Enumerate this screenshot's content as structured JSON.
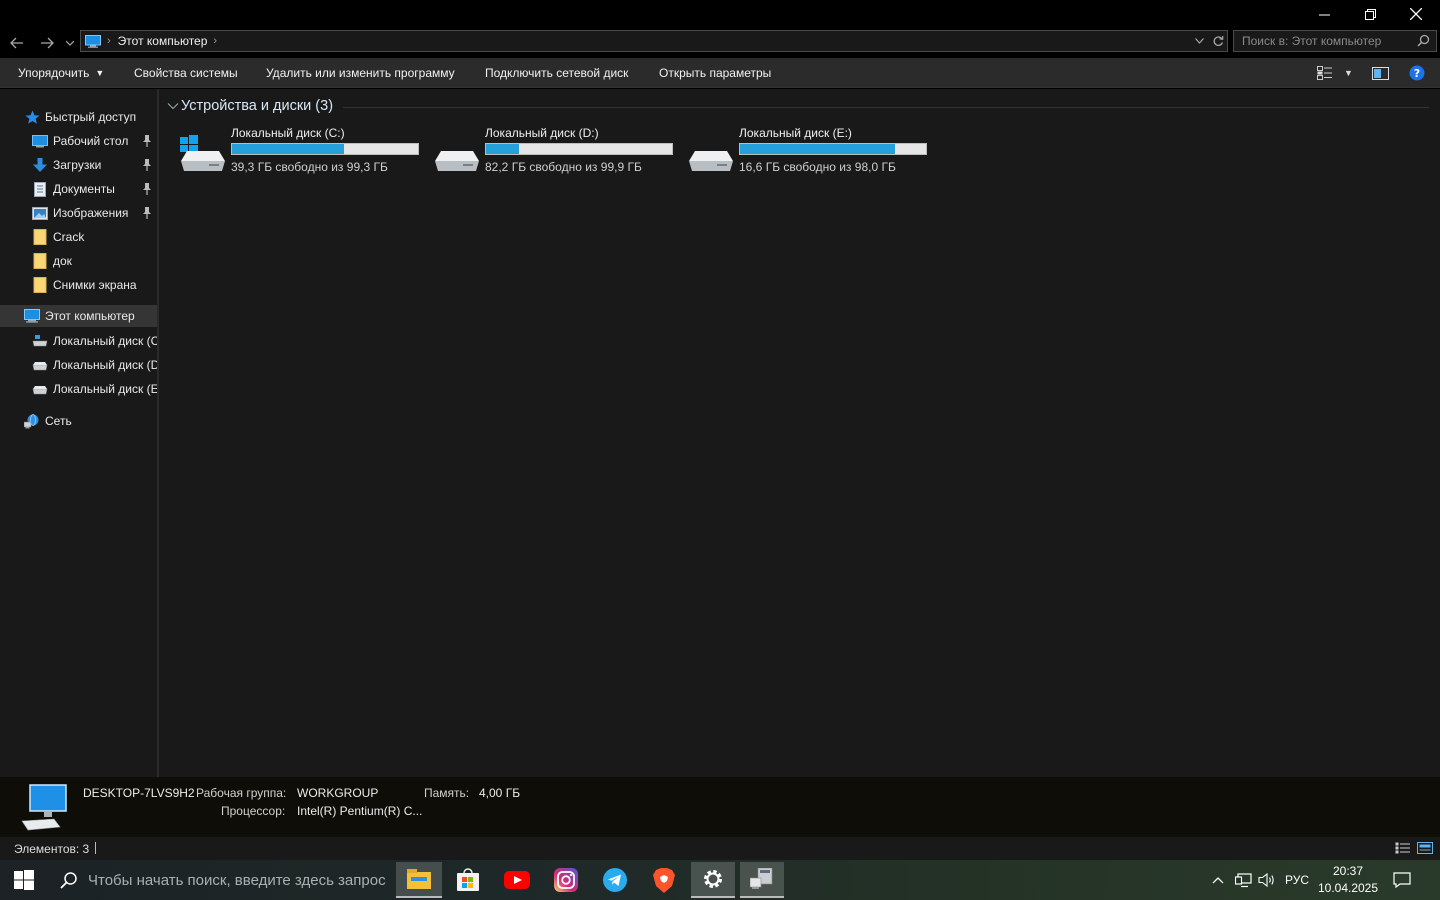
{
  "window": {
    "controls": {
      "minimize": "minimize-icon",
      "maximize": "restore-icon",
      "close": "close-icon"
    }
  },
  "address": {
    "path": [
      "Этот компьютер"
    ],
    "search_placeholder": "Поиск в: Этот компьютер"
  },
  "command_bar": {
    "organize": "Упорядочить",
    "system_properties": "Свойства системы",
    "uninstall": "Удалить или изменить программу",
    "map_drive": "Подключить сетевой диск",
    "open_settings": "Открыть параметры"
  },
  "nav": {
    "quick_access": "Быстрый доступ",
    "items": [
      {
        "label": "Рабочий стол",
        "icon": "desktop-icon",
        "pinned": true
      },
      {
        "label": "Загрузки",
        "icon": "download-icon",
        "pinned": true
      },
      {
        "label": "Документы",
        "icon": "documents-icon",
        "pinned": true
      },
      {
        "label": "Изображения",
        "icon": "pictures-icon",
        "pinned": true
      },
      {
        "label": "Crack",
        "icon": "folder-icon",
        "pinned": false
      },
      {
        "label": "док",
        "icon": "folder-icon",
        "pinned": false
      },
      {
        "label": "Снимки экрана",
        "icon": "folder-icon",
        "pinned": false
      }
    ],
    "this_pc": "Этот компьютер",
    "drives": [
      "Локальный диск (C:)",
      "Локальный диск (D:)",
      "Локальный диск (E:)"
    ],
    "network": "Сеть"
  },
  "content": {
    "group_title": "Устройства и диски (3)",
    "drives": [
      {
        "name": "Локальный диск (C:)",
        "free": "39,3 ГБ свободно из 99,3 ГБ",
        "used_fraction": 0.604,
        "system": true
      },
      {
        "name": "Локальный диск (D:)",
        "free": "82,2 ГБ свободно из 99,9 ГБ",
        "used_fraction": 0.177,
        "system": false
      },
      {
        "name": "Локальный диск (E:)",
        "free": "16,6 ГБ свободно из 98,0 ГБ",
        "used_fraction": 0.831,
        "system": false
      }
    ]
  },
  "details": {
    "computer_name": "DESKTOP-7LVS9H2",
    "workgroup_label": "Рабочая группа:",
    "workgroup": "WORKGROUP",
    "memory_label": "Память:",
    "memory": "4,00 ГБ",
    "cpu_label": "Процессор:",
    "cpu": "Intel(R) Pentium(R) C..."
  },
  "status": {
    "items": "Элементов: 3"
  },
  "taskbar": {
    "search_placeholder": "Чтобы начать поиск, введите здесь запрос",
    "apps": [
      "file-explorer-icon",
      "store-icon",
      "youtube-icon",
      "instagram-icon",
      "telegram-icon",
      "brave-icon",
      "settings-icon",
      "device-manager-icon"
    ],
    "language": "РУС",
    "time": "20:37",
    "date": "10.04.2025"
  },
  "colors": {
    "accent": "#26a0da",
    "folder": "#f8d775"
  }
}
